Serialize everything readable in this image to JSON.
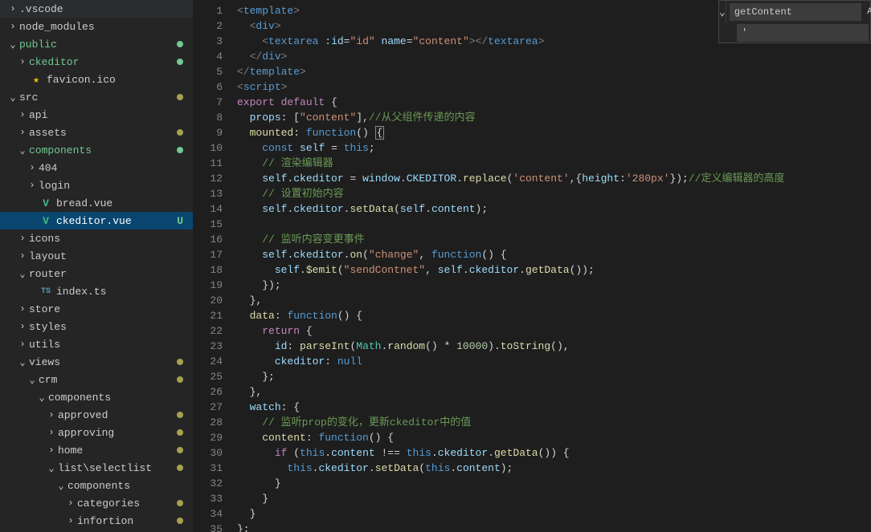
{
  "sidebar": {
    "vscode": ".vscode",
    "node_modules": "node_modules",
    "public": "public",
    "ckeditor_folder": "ckeditor",
    "favicon": "favicon.ico",
    "src": "src",
    "api": "api",
    "assets": "assets",
    "components": "components",
    "n404": "404",
    "login": "login",
    "bread": "bread.vue",
    "ckeditor_file": "ckeditor.vue",
    "ckeditor_badge": "U",
    "icons": "icons",
    "layout": "layout",
    "router": "router",
    "index_ts": "index.ts",
    "store": "store",
    "styles": "styles",
    "utils": "utils",
    "views": "views",
    "crm": "crm",
    "crm_components": "components",
    "approved": "approved",
    "approving": "approving",
    "home": "home",
    "list_selectlist": "list\\selectlist",
    "ls_components": "components",
    "categories": "categories",
    "infortion": "infortion",
    "ts_icon": "TS"
  },
  "find": {
    "value": "getContent",
    "opt_case": "Aa",
    "opt_word": "",
    "replace": "'"
  },
  "lines": [
    "1",
    "2",
    "3",
    "4",
    "5",
    "6",
    "7",
    "8",
    "9",
    "10",
    "11",
    "12",
    "13",
    "14",
    "15",
    "16",
    "17",
    "18",
    "19",
    "20",
    "21",
    "22",
    "23",
    "24",
    "25",
    "26",
    "27",
    "28",
    "29",
    "30",
    "31",
    "32",
    "33",
    "34",
    "35"
  ],
  "code": {
    "c3_main": "//从父组件传递的内容",
    "c_render": "// 渲染编辑器",
    "c_def_h": "//定义编辑器的高度",
    "c_init": "// 设置初始内容",
    "c_listen": "// 监听内容变更事件",
    "c_watch": "// 监听prop的变化，更新ckeditor中的值",
    "s_content_prop": "\"content\"",
    "s_content": "'content'",
    "s_height": "'280px'",
    "s_change": "\"change\"",
    "s_sendContnet": "\"sendContnet\"",
    "s_id_attr": "\"id\"",
    "s_name_v": "\"content\""
  }
}
